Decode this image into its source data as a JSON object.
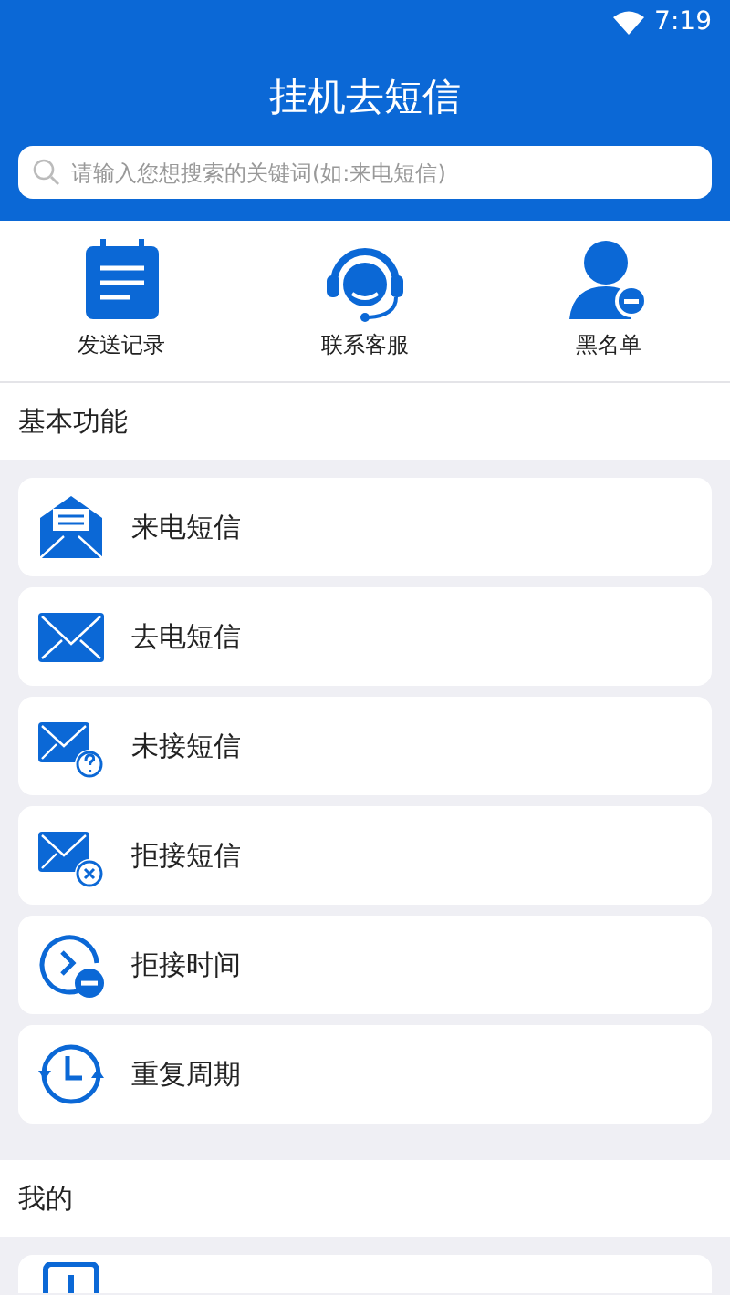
{
  "status_bar": {
    "time": "7:19"
  },
  "header": {
    "title": "挂机去短信"
  },
  "search": {
    "placeholder": "请输入您想搜索的关键词(如:来电短信)"
  },
  "shortcuts": [
    {
      "kind": "record",
      "label": "发送记录"
    },
    {
      "kind": "service",
      "label": "联系客服"
    },
    {
      "kind": "blacklist",
      "label": "黑名单"
    }
  ],
  "sections": [
    {
      "title": "基本功能",
      "items": [
        {
          "kind": "incoming",
          "label": "来电短信"
        },
        {
          "kind": "outgoing",
          "label": "去电短信"
        },
        {
          "kind": "missed",
          "label": "未接短信"
        },
        {
          "kind": "rejected",
          "label": "拒接短信"
        },
        {
          "kind": "reject_time",
          "label": "拒接时间"
        },
        {
          "kind": "repeat",
          "label": "重复周期"
        }
      ]
    },
    {
      "title": "我的",
      "items": [
        {
          "kind": "partial"
        }
      ]
    }
  ]
}
